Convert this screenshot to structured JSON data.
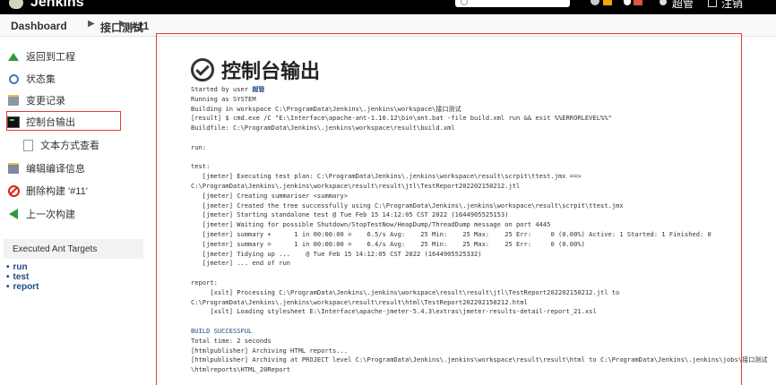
{
  "header": {
    "logo": "Jenkins",
    "user": "超管",
    "logout": "注销"
  },
  "breadcrumb": [
    "Dashboard",
    "接口测试",
    "#11"
  ],
  "sidebar": {
    "items": [
      {
        "label": "返回到工程",
        "icon": "up-arrow-icon"
      },
      {
        "label": "状态集",
        "icon": "search-icon"
      },
      {
        "label": "变更记录",
        "icon": "changes-icon"
      },
      {
        "label": "控制台输出",
        "icon": "terminal-icon"
      },
      {
        "label": "文本方式查看",
        "icon": "text-file-icon"
      },
      {
        "label": "编辑编译信息",
        "icon": "edit-icon"
      },
      {
        "label": "删除构建 '#11'",
        "icon": "delete-icon"
      },
      {
        "label": "上一次构建",
        "icon": "previous-arrow-icon"
      }
    ],
    "ant_targets_title": "Executed Ant Targets",
    "ant_targets": [
      "run",
      "test",
      "report"
    ]
  },
  "main": {
    "title": "控制台输出",
    "console": {
      "started_prefix": "Started by user ",
      "started_user": "超管",
      "lines_a": [
        "Running as SYSTEM",
        "Building in workspace C:\\ProgramData\\Jenkins\\.jenkins\\workspace\\接口测试",
        "[result] $ cmd.exe /C \"E:\\Interface\\apache-ant-1.10.12\\bin\\ant.bat -file build.xml run && exit %%ERRORLEVEL%%\"",
        "Buildfile: C:\\ProgramData\\Jenkins\\.jenkins\\workspace\\result\\build.xml",
        "",
        "run:",
        "",
        "test:",
        "   [jmeter] Executing test plan: C:\\ProgramData\\Jenkins\\.jenkins\\workspace\\result\\scrpit\\ttest.jmx ==>",
        "C:\\ProgramData\\Jenkins\\.jenkins\\workspace\\result\\result\\jtl\\TestReport202202150212.jtl",
        "   [jmeter] Creating summariser <summary>",
        "   [jmeter] Created the tree successfully using C:\\ProgramData\\Jenkins\\.jenkins\\workspace\\result\\scrpit\\ttest.jmx",
        "   [jmeter] Starting standalone test @ Tue Feb 15 14:12:05 CST 2022 (1644905525153)",
        "   [jmeter] Waiting for possible Shutdown/StopTestNow/HeapDump/ThreadDump message on port 4445",
        "   [jmeter] summary +      1 in 00:00:00 =    6.5/s Avg:    25 Min:    25 Max:    25 Err:     0 (0.00%) Active: 1 Started: 1 Finished: 0",
        "   [jmeter] summary =      1 in 00:00:00 =    6.4/s Avg:    25 Min:    25 Max:    25 Err:     0 (0.00%)",
        "   [jmeter] Tidying up ...    @ Tue Feb 15 14:12:05 CST 2022 (1644905525332)",
        "   [jmeter] ... end of run",
        "",
        "report:",
        "     [xslt] Processing C:\\ProgramData\\Jenkins\\.jenkins\\workspace\\result\\result\\jtl\\TestReport202202150212.jtl to",
        "C:\\ProgramData\\Jenkins\\.jenkins\\workspace\\result\\result\\html\\TestReport202202150212.html",
        "     [xslt] Loading stylesheet E:\\Interface\\apache-jmeter-5.4.3\\extras\\jmeter-results-detail-report_21.xsl",
        ""
      ],
      "build_status": "BUILD SUCCESSFUL",
      "lines_b": [
        "Total time: 2 seconds",
        "[htmlpublisher] Archiving HTML reports...",
        "[htmlpublisher] Archiving at PROJECT level C:\\ProgramData\\Jenkins\\.jenkins\\workspace\\result\\result\\html to C:\\ProgramData\\Jenkins\\.jenkins\\jobs\\接口测试",
        "\\htmlreports\\HTML_20Report"
      ]
    }
  },
  "colors": {
    "header_bg": "#000000",
    "highlight": "#e23b3b",
    "link": "#204a87",
    "success_green": "#2e9b3d"
  }
}
